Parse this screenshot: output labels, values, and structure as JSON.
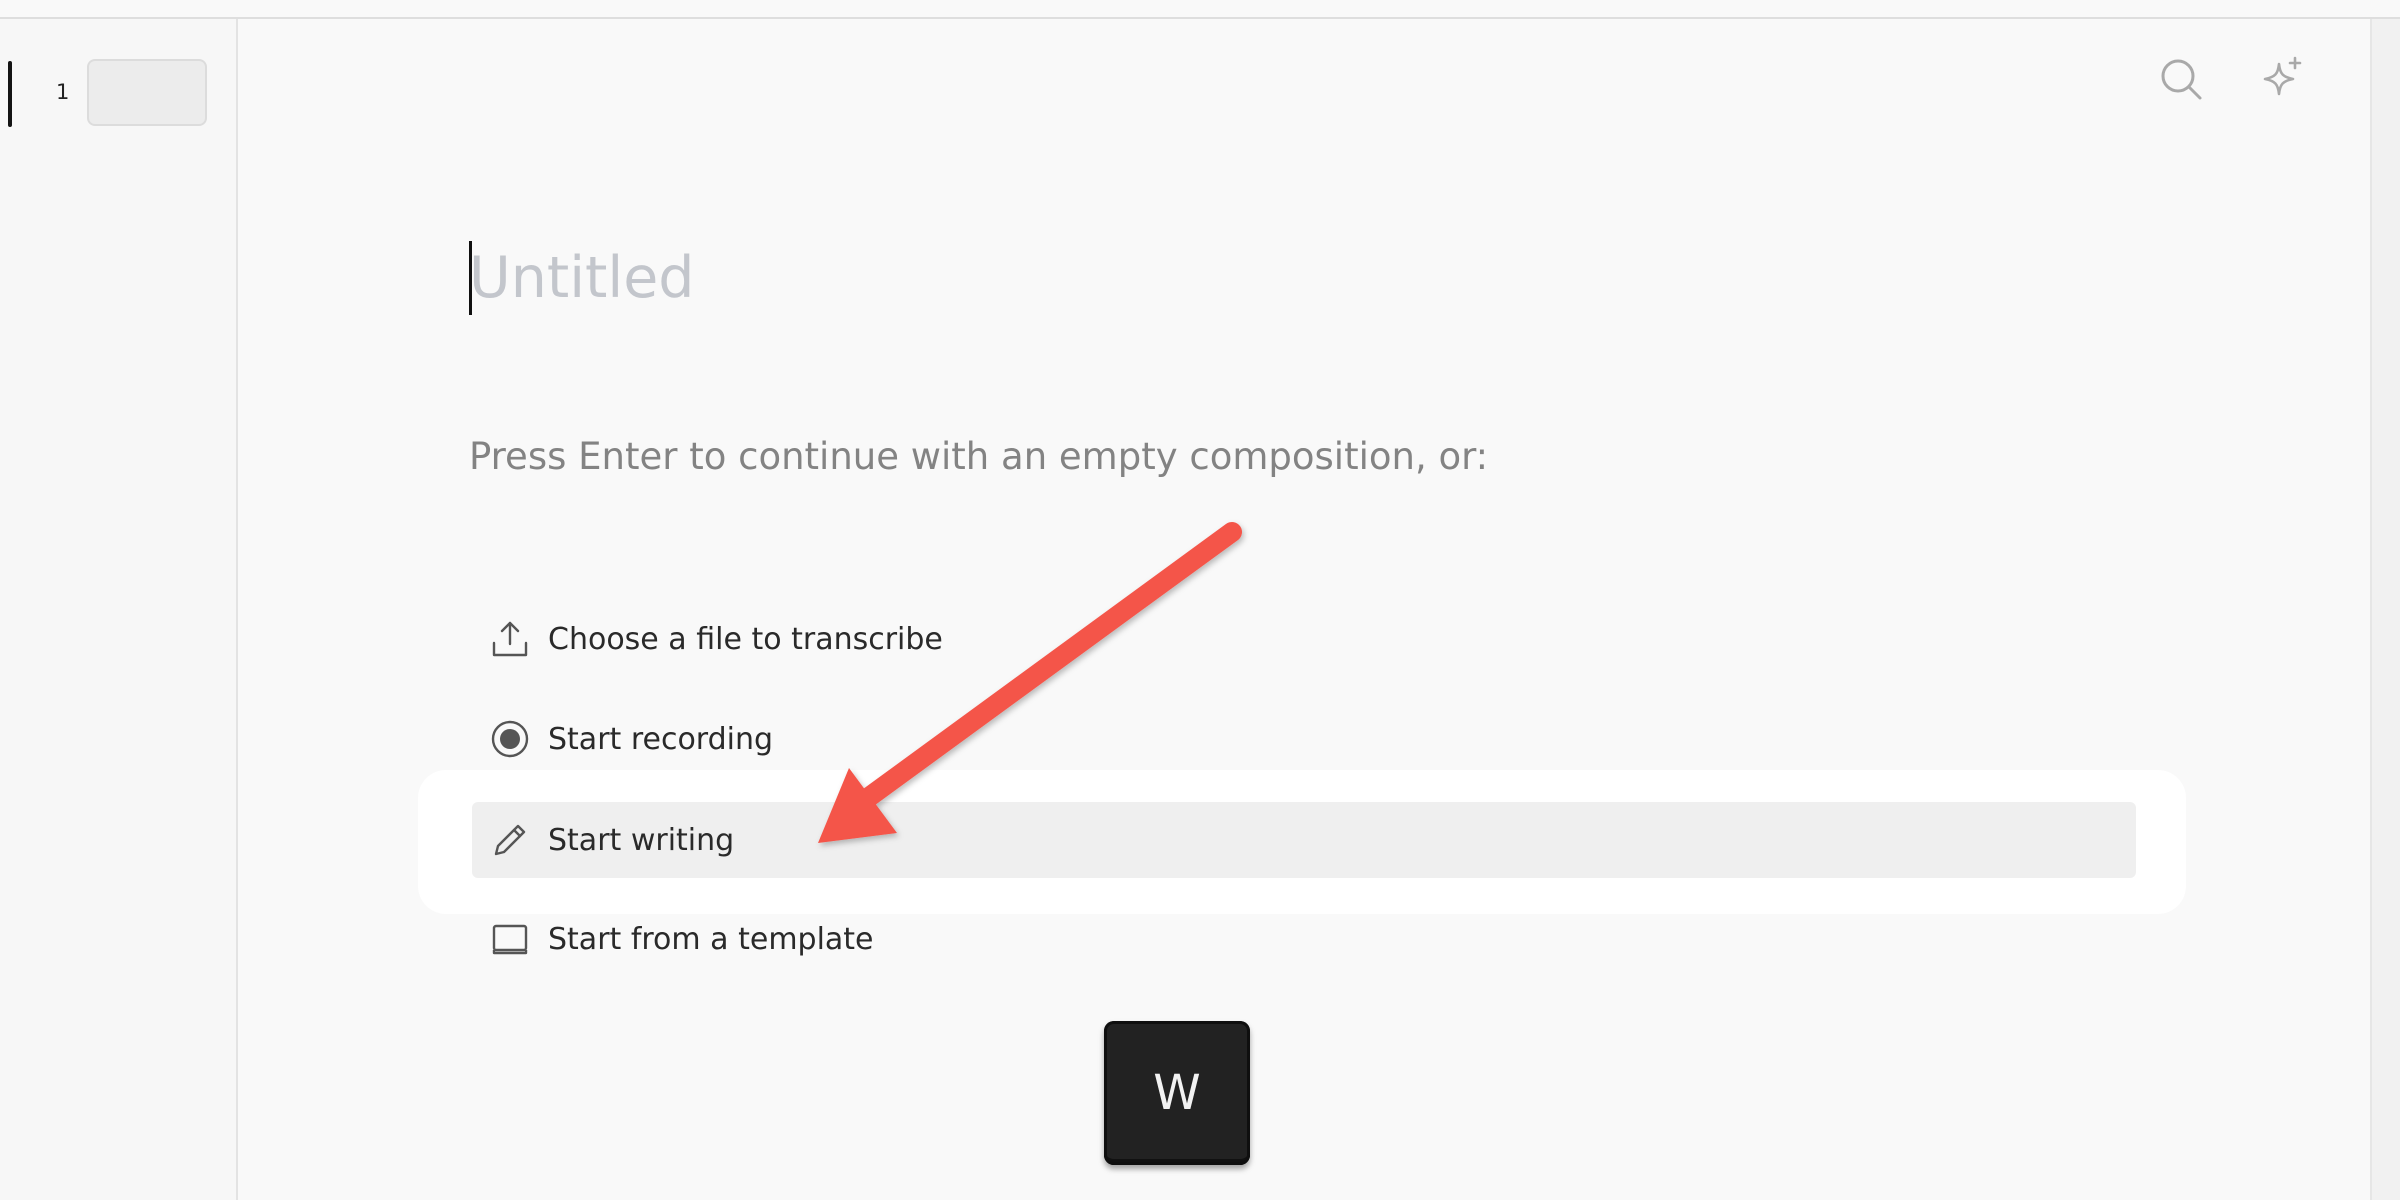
{
  "sidebar": {
    "page_number": "1"
  },
  "document": {
    "title_placeholder": "Untitled",
    "prompt": "Press Enter to continue with an empty composition, or:"
  },
  "options": [
    {
      "label": "Choose a file to transcribe",
      "icon": "upload-icon"
    },
    {
      "label": "Start recording",
      "icon": "record-icon"
    },
    {
      "label": "Start writing",
      "icon": "pencil-icon",
      "highlighted": true
    },
    {
      "label": "Start from a template",
      "icon": "template-icon"
    }
  ],
  "toolbar": {
    "search_icon": "search-icon",
    "ai_icon": "sparkle-icon"
  },
  "keystroke": {
    "key": "W"
  },
  "colors": {
    "arrow": "#f4554a",
    "background": "#f9f9f9",
    "placeholder": "#c3c6cc",
    "highlight_row": "#efefef"
  }
}
